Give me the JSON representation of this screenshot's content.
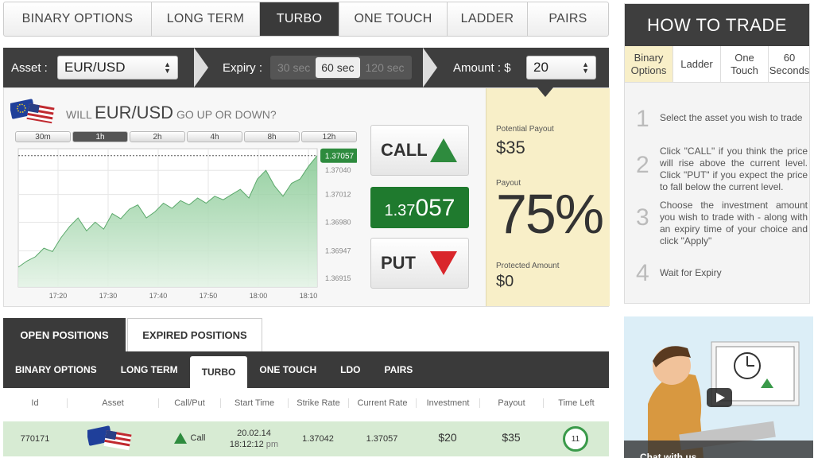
{
  "top_tabs": [
    {
      "label": "BINARY OPTIONS",
      "active": false
    },
    {
      "label": "LONG TERM",
      "active": false
    },
    {
      "label": "TURBO",
      "active": true
    },
    {
      "label": "ONE TOUCH",
      "active": false
    },
    {
      "label": "LADDER",
      "active": false
    },
    {
      "label": "PAIRS",
      "active": false
    }
  ],
  "controls": {
    "asset_label": "Asset :",
    "asset_value": "EUR/USD",
    "expiry_label": "Expiry :",
    "expiry_options": [
      "30 sec",
      "60 sec",
      "120 sec"
    ],
    "expiry_selected": "60 sec",
    "amount_label": "Amount : $",
    "amount_value": "20"
  },
  "question": {
    "prefix": "WILL",
    "asset": "EUR/USD",
    "suffix": "GO UP OR DOWN?"
  },
  "time_tabs": [
    "30m",
    "1h",
    "2h",
    "4h",
    "8h",
    "12h"
  ],
  "time_tab_active": "1h",
  "chart_data": {
    "type": "area",
    "x_ticks": [
      "17:20",
      "17:30",
      "17:40",
      "17:50",
      "18:00",
      "18:10"
    ],
    "y_ticks": [
      "1.37040",
      "1.37012",
      "1.36980",
      "1.36947",
      "1.36915"
    ],
    "current_value": "1.37057",
    "series": [
      {
        "values": [
          1.36928,
          1.36935,
          1.3694,
          1.3695,
          1.36946,
          1.36962,
          1.36975,
          1.36985,
          1.3697,
          1.3698,
          1.36972,
          1.3699,
          1.36984,
          1.36995,
          1.37,
          1.36985,
          1.36992,
          1.37002,
          1.36996,
          1.37005,
          1.37,
          1.37008,
          1.37002,
          1.3701,
          1.37006,
          1.37012,
          1.37018,
          1.37008,
          1.3703,
          1.3704,
          1.37022,
          1.3701,
          1.37025,
          1.3703,
          1.37045,
          1.37057
        ]
      }
    ],
    "ylim": [
      1.36905,
      1.37065
    ],
    "grid": true,
    "color": "#7cc48a"
  },
  "call": {
    "label": "CALL"
  },
  "put": {
    "label": "PUT"
  },
  "rate": {
    "prefix": "1.37",
    "suffix": "057"
  },
  "payout": {
    "potential_label": "Potential Payout",
    "potential_value": "$35",
    "payout_label": "Payout",
    "payout_value": "75%",
    "protected_label": "Protected Amount",
    "protected_value": "$0"
  },
  "how_to": {
    "title": "HOW TO TRADE",
    "tabs": [
      {
        "label": "Binary Options",
        "active": true
      },
      {
        "label": "Ladder",
        "active": false
      },
      {
        "label": "One Touch",
        "active": false
      },
      {
        "label": "60 Seconds",
        "active": false
      }
    ],
    "steps": [
      {
        "num": "1",
        "text": "Select the asset you wish to trade"
      },
      {
        "num": "2",
        "text": "Click \"CALL\" if you think the price will rise above the current level. Click \"PUT\" if you expect the price to fall below the current level."
      },
      {
        "num": "3",
        "text": "Choose the investment amount you wish to trade with - along with an expiry time of your choice and click \"Apply\""
      },
      {
        "num": "4",
        "text": "Wait for Expiry"
      }
    ]
  },
  "positions": {
    "tabs": [
      "OPEN POSITIONS",
      "EXPIRED POSITIONS"
    ],
    "type_tabs": [
      "BINARY OPTIONS",
      "LONG TERM",
      "TURBO",
      "ONE TOUCH",
      "LDO",
      "PAIRS"
    ],
    "type_active": "TURBO",
    "columns": [
      "Id",
      "Asset",
      "Call/Put",
      "Start Time",
      "Strike Rate",
      "Current Rate",
      "Investment",
      "Payout",
      "Time Left"
    ],
    "row": {
      "id": "770171",
      "direction": "Call",
      "date": "20.02.14",
      "time": "18:12:12",
      "ampm": "pm",
      "strike": "1.37042",
      "current": "1.37057",
      "investment": "$20",
      "payout": "$35",
      "time_left": "11"
    }
  },
  "video": {
    "caption": "Chat with us"
  },
  "colors": {
    "green": "#2e8b3e",
    "red": "#d9262b",
    "dark": "#3a3a3a",
    "yellow": "#f8efc8"
  }
}
